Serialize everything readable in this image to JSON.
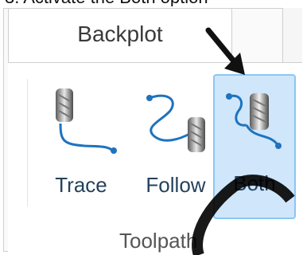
{
  "caption": "3.  Activate the Both option",
  "ribbon": {
    "tab_label": "Backplot",
    "group_label": "Toolpath",
    "buttons": [
      {
        "label": "Trace",
        "icon": "trace-toolpath-icon",
        "active": false
      },
      {
        "label": "Follow",
        "icon": "follow-toolpath-icon",
        "active": false
      },
      {
        "label": "Both",
        "icon": "both-toolpath-icon",
        "active": true
      }
    ]
  },
  "colors": {
    "accent": "#1e73be",
    "active_bg": "#cfe6fb",
    "active_border": "#8cc6f4",
    "label_text": "#25425c"
  }
}
